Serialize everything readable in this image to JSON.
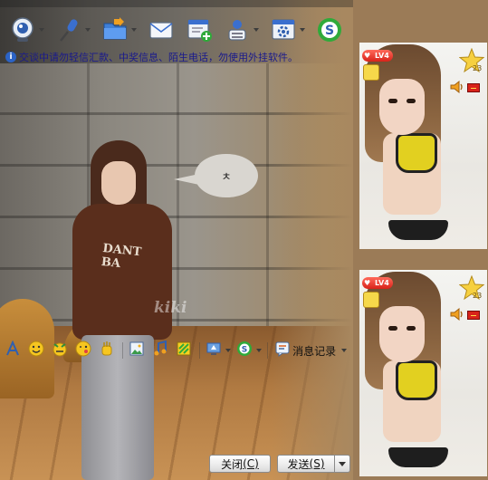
{
  "notice": {
    "icon": "info-shield-icon",
    "text": "交谈中请勿轻信汇款、中奖信息、陌生电话，勿使用外挂软件。"
  },
  "toolbar": {
    "buttons": [
      {
        "name": "video-chat",
        "icon": "webcam-icon"
      },
      {
        "name": "voice-chat",
        "icon": "microphone-icon"
      },
      {
        "name": "send-file",
        "icon": "folder-icon"
      },
      {
        "name": "send-message",
        "icon": "envelope-icon"
      },
      {
        "name": "create-group",
        "icon": "add-contact-icon"
      },
      {
        "name": "remote-assist",
        "icon": "remote-user-icon"
      },
      {
        "name": "apps",
        "icon": "gear-window-icon"
      },
      {
        "name": "payment",
        "icon": "s-coin-icon"
      }
    ]
  },
  "bubble": {
    "text": "ㅊ"
  },
  "photo": {
    "shirt_print": "DANT\nBA",
    "watermark": "kiki"
  },
  "format_toolbar": {
    "history_label": "消息记录"
  },
  "buttons": {
    "close_label": "关闭",
    "close_shortcut": "(C)",
    "send_label": "发送",
    "send_shortcut": "(S)"
  },
  "side_panel": {
    "top_show": {
      "level": "LV4",
      "star_count": "23"
    },
    "bottom_show": {
      "level": "LV4",
      "star_count": "23"
    }
  },
  "colors": {
    "notice_text": "#1a1a8c",
    "level_badge": "#d8231a",
    "bikini_top": "#e2d020"
  }
}
